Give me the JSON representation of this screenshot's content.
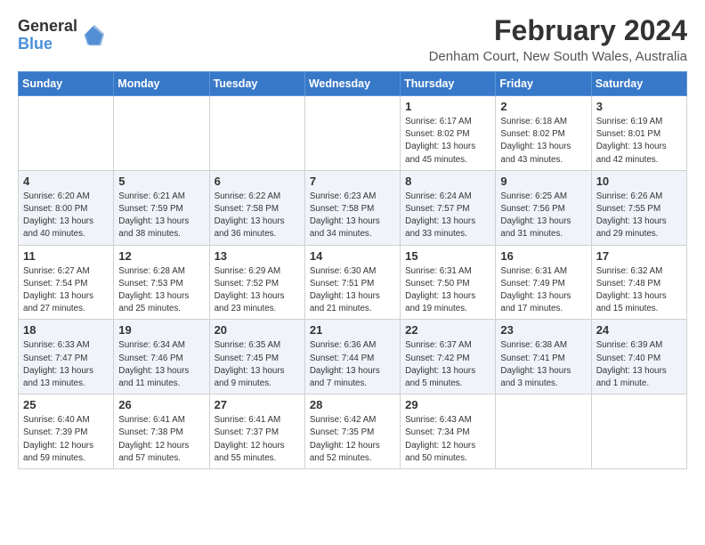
{
  "header": {
    "logo_line1": "General",
    "logo_line2": "Blue",
    "month_year": "February 2024",
    "location": "Denham Court, New South Wales, Australia"
  },
  "days_of_week": [
    "Sunday",
    "Monday",
    "Tuesday",
    "Wednesday",
    "Thursday",
    "Friday",
    "Saturday"
  ],
  "weeks": [
    [
      {
        "day": "",
        "info": ""
      },
      {
        "day": "",
        "info": ""
      },
      {
        "day": "",
        "info": ""
      },
      {
        "day": "",
        "info": ""
      },
      {
        "day": "1",
        "info": "Sunrise: 6:17 AM\nSunset: 8:02 PM\nDaylight: 13 hours\nand 45 minutes."
      },
      {
        "day": "2",
        "info": "Sunrise: 6:18 AM\nSunset: 8:02 PM\nDaylight: 13 hours\nand 43 minutes."
      },
      {
        "day": "3",
        "info": "Sunrise: 6:19 AM\nSunset: 8:01 PM\nDaylight: 13 hours\nand 42 minutes."
      }
    ],
    [
      {
        "day": "4",
        "info": "Sunrise: 6:20 AM\nSunset: 8:00 PM\nDaylight: 13 hours\nand 40 minutes."
      },
      {
        "day": "5",
        "info": "Sunrise: 6:21 AM\nSunset: 7:59 PM\nDaylight: 13 hours\nand 38 minutes."
      },
      {
        "day": "6",
        "info": "Sunrise: 6:22 AM\nSunset: 7:58 PM\nDaylight: 13 hours\nand 36 minutes."
      },
      {
        "day": "7",
        "info": "Sunrise: 6:23 AM\nSunset: 7:58 PM\nDaylight: 13 hours\nand 34 minutes."
      },
      {
        "day": "8",
        "info": "Sunrise: 6:24 AM\nSunset: 7:57 PM\nDaylight: 13 hours\nand 33 minutes."
      },
      {
        "day": "9",
        "info": "Sunrise: 6:25 AM\nSunset: 7:56 PM\nDaylight: 13 hours\nand 31 minutes."
      },
      {
        "day": "10",
        "info": "Sunrise: 6:26 AM\nSunset: 7:55 PM\nDaylight: 13 hours\nand 29 minutes."
      }
    ],
    [
      {
        "day": "11",
        "info": "Sunrise: 6:27 AM\nSunset: 7:54 PM\nDaylight: 13 hours\nand 27 minutes."
      },
      {
        "day": "12",
        "info": "Sunrise: 6:28 AM\nSunset: 7:53 PM\nDaylight: 13 hours\nand 25 minutes."
      },
      {
        "day": "13",
        "info": "Sunrise: 6:29 AM\nSunset: 7:52 PM\nDaylight: 13 hours\nand 23 minutes."
      },
      {
        "day": "14",
        "info": "Sunrise: 6:30 AM\nSunset: 7:51 PM\nDaylight: 13 hours\nand 21 minutes."
      },
      {
        "day": "15",
        "info": "Sunrise: 6:31 AM\nSunset: 7:50 PM\nDaylight: 13 hours\nand 19 minutes."
      },
      {
        "day": "16",
        "info": "Sunrise: 6:31 AM\nSunset: 7:49 PM\nDaylight: 13 hours\nand 17 minutes."
      },
      {
        "day": "17",
        "info": "Sunrise: 6:32 AM\nSunset: 7:48 PM\nDaylight: 13 hours\nand 15 minutes."
      }
    ],
    [
      {
        "day": "18",
        "info": "Sunrise: 6:33 AM\nSunset: 7:47 PM\nDaylight: 13 hours\nand 13 minutes."
      },
      {
        "day": "19",
        "info": "Sunrise: 6:34 AM\nSunset: 7:46 PM\nDaylight: 13 hours\nand 11 minutes."
      },
      {
        "day": "20",
        "info": "Sunrise: 6:35 AM\nSunset: 7:45 PM\nDaylight: 13 hours\nand 9 minutes."
      },
      {
        "day": "21",
        "info": "Sunrise: 6:36 AM\nSunset: 7:44 PM\nDaylight: 13 hours\nand 7 minutes."
      },
      {
        "day": "22",
        "info": "Sunrise: 6:37 AM\nSunset: 7:42 PM\nDaylight: 13 hours\nand 5 minutes."
      },
      {
        "day": "23",
        "info": "Sunrise: 6:38 AM\nSunset: 7:41 PM\nDaylight: 13 hours\nand 3 minutes."
      },
      {
        "day": "24",
        "info": "Sunrise: 6:39 AM\nSunset: 7:40 PM\nDaylight: 13 hours\nand 1 minute."
      }
    ],
    [
      {
        "day": "25",
        "info": "Sunrise: 6:40 AM\nSunset: 7:39 PM\nDaylight: 12 hours\nand 59 minutes."
      },
      {
        "day": "26",
        "info": "Sunrise: 6:41 AM\nSunset: 7:38 PM\nDaylight: 12 hours\nand 57 minutes."
      },
      {
        "day": "27",
        "info": "Sunrise: 6:41 AM\nSunset: 7:37 PM\nDaylight: 12 hours\nand 55 minutes."
      },
      {
        "day": "28",
        "info": "Sunrise: 6:42 AM\nSunset: 7:35 PM\nDaylight: 12 hours\nand 52 minutes."
      },
      {
        "day": "29",
        "info": "Sunrise: 6:43 AM\nSunset: 7:34 PM\nDaylight: 12 hours\nand 50 minutes."
      },
      {
        "day": "",
        "info": ""
      },
      {
        "day": "",
        "info": ""
      }
    ]
  ]
}
